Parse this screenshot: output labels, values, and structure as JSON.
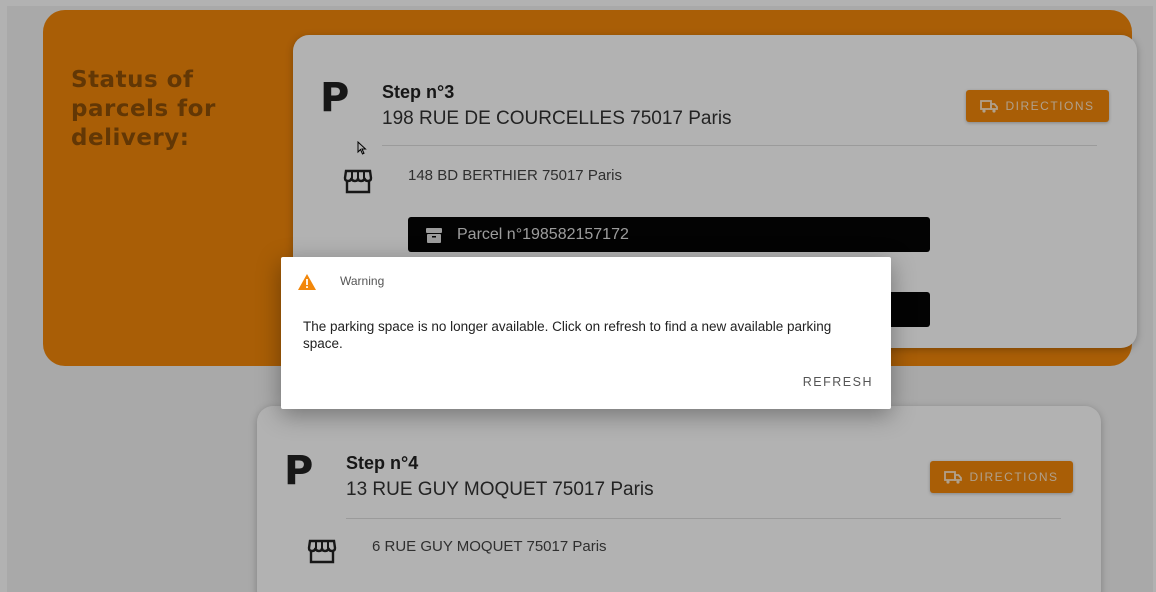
{
  "sidebar": {
    "heading": "Status of parcels for delivery:"
  },
  "steps": [
    {
      "title": "Step n°3",
      "address": "198 RUE DE COURCELLES 75017 Paris",
      "directions_label": "DIRECTIONS",
      "store_address": "148 BD BERTHIER 75017 Paris",
      "parcel_label": "Parcel n°198582157172"
    },
    {
      "title": "Step n°4",
      "address": "13 RUE GUY MOQUET 75017 Paris",
      "directions_label": "DIRECTIONS",
      "store_address": "6 RUE GUY MOQUET 75017 Paris"
    }
  ],
  "dialog": {
    "title": "Warning",
    "message": "The parking space is no longer available. Click on refresh to find a new available parking space.",
    "action_label": "REFRESH"
  },
  "colors": {
    "accent": "#f2870a",
    "heading_text": "#8d4f08",
    "warning": "#f2870a"
  },
  "icons": {
    "parking": "P",
    "truck": "truck-icon",
    "store": "store-icon",
    "parcel": "parcel-icon",
    "warning": "warning-icon"
  }
}
